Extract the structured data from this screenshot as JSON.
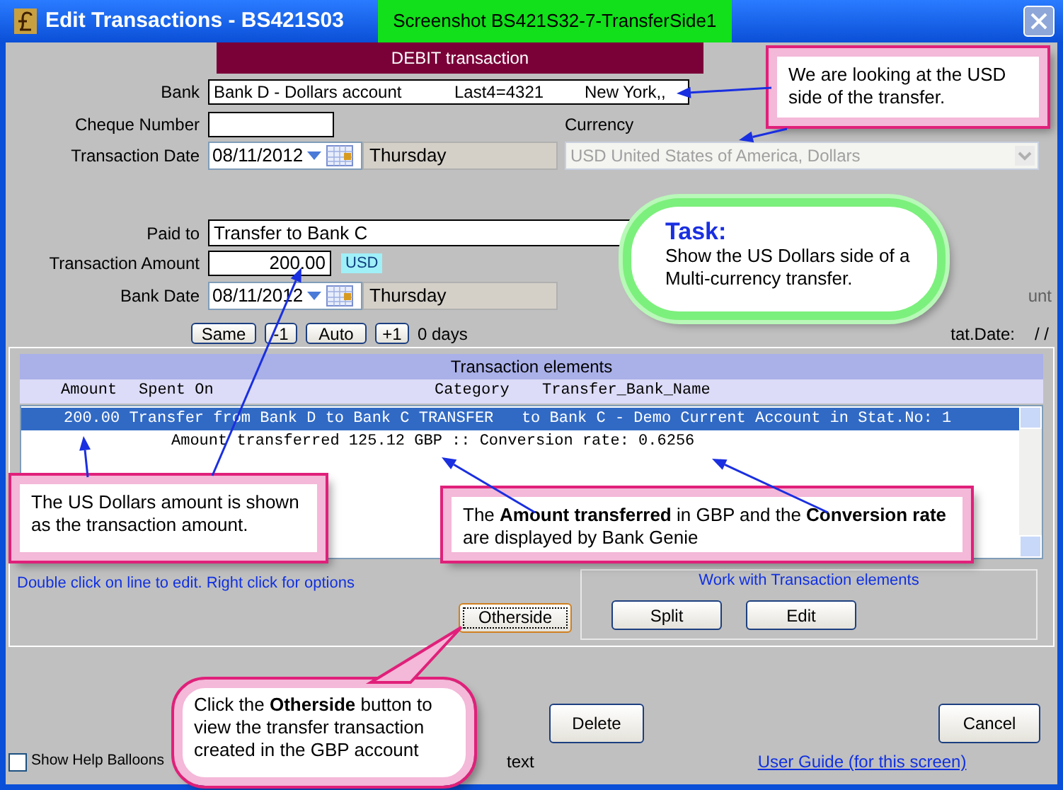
{
  "window": {
    "title": "Edit Transactions - BS421S03"
  },
  "screenshot_label": "Screenshot BS421S32-7-TransferSide1",
  "banner": "DEBIT transaction",
  "form": {
    "bank": {
      "label": "Bank",
      "name": "Bank D - Dollars account",
      "last4": "Last4=4321",
      "location": "New York,,"
    },
    "cheque_number": {
      "label": "Cheque Number"
    },
    "currency": {
      "label": "Currency",
      "value": "USD United States of America, Dollars",
      "disabled": true
    },
    "transaction_date": {
      "label": "Transaction Date",
      "value": "08/11/2012",
      "day": "Thursday"
    },
    "paid_to": {
      "label": "Paid to",
      "value": "Transfer to Bank C"
    },
    "amount": {
      "label": "Transaction Amount",
      "value": "200.00",
      "currency": "USD"
    },
    "bank_date": {
      "label": "Bank Date",
      "value": "08/11/2012",
      "day": "Thursday"
    },
    "account_fragment": "unt",
    "date_buttons": [
      "Same",
      "-1",
      "Auto",
      "+1"
    ],
    "days": "0 days",
    "stat_date": {
      "label": "tat.Date:",
      "value": "/ /"
    }
  },
  "elements": {
    "title": "Transaction elements",
    "columns": [
      "Amount",
      "Spent On",
      "Category",
      "Transfer_Bank_Name"
    ],
    "rows": [
      {
        "text": "200.00 Transfer from Bank D to Bank C TRANSFER   to Bank C - Demo Current Account in Stat.No: 1",
        "selected": true
      },
      {
        "text": "Amount transferred 125.12 GBP :: Conversion rate: 0.6256",
        "selected": false
      }
    ],
    "hint": "Double click on line to edit. Right click for options"
  },
  "otherside_button": "Otherside",
  "work_group": {
    "title": "Work with Transaction elements",
    "buttons": [
      "Split",
      "Edit"
    ]
  },
  "bottom_buttons": [
    "Delete",
    "Cancel"
  ],
  "show_help_balloons": {
    "label": "Show Help Balloons",
    "checked": false
  },
  "text_fragment": "text",
  "user_guide_link": "User Guide (for this screen)",
  "callouts": [
    {
      "kind": "box",
      "text": "We are looking at the USD side of the transfer."
    },
    {
      "kind": "cloud",
      "title": "Task:",
      "text": "Show the US Dollars side of a Multi-currency transfer."
    },
    {
      "kind": "box",
      "text": "The US Dollars amount is shown as the transaction amount."
    },
    {
      "kind": "box",
      "text": "The **Amount transferred** in GBP and the **Conversion rate** are displayed by Bank Genie"
    },
    {
      "kind": "bubble",
      "text": "Click the **Otherside** button to view the transfer transaction created in the GBP account"
    }
  ]
}
